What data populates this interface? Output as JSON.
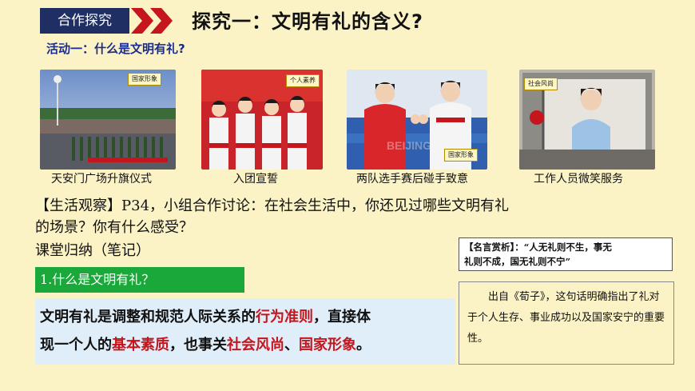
{
  "header": {
    "badge": "合作探究",
    "title": "探究一：文明有礼的含义?"
  },
  "activity": "活动一：什么是文明有礼?",
  "photos": [
    {
      "tag": "国家形象",
      "caption": "天安门广场升旗仪式"
    },
    {
      "tag": "个人素养",
      "caption": "入团宣誓"
    },
    {
      "tag": "国家形象",
      "caption": "两队选手赛后碰手致意"
    },
    {
      "tag": "社会风尚",
      "caption": "工作人员微笑服务"
    }
  ],
  "observation": {
    "line1": "【生活观察】P34，小组合作讨论：在社会生活中，你还见过哪些文明有礼",
    "line2": "的场景？你有什么感受？"
  },
  "summary_label": "课堂归纳（笔记）",
  "question": "1.什么是文明有礼？",
  "definition": {
    "p1": "文明有礼是调整和规范人际关系的",
    "h1": "行为准则",
    "p2": "，直接体",
    "p3": "现一个人的",
    "h2": "基本素质",
    "p4": "，也事关",
    "h3": "社会风尚",
    "p5": "、",
    "h4": "国家形象",
    "p6": "。"
  },
  "quote": {
    "line1": "【名言赏析】：“人无礼则不生，事无",
    "line2": "礼则不成，国无礼则不宁”"
  },
  "explanation": "出自《荀子》，这句话明确指出了礼对于个人生存、事业成功以及国家安宁的重要性。",
  "colors": {
    "background": "#fbf2c6",
    "badge": "#1f2f63",
    "chevron": "#c4161c",
    "highlight": "#c4161c",
    "green_bar": "#1aa83a",
    "definition_box": "#dfeef9"
  }
}
